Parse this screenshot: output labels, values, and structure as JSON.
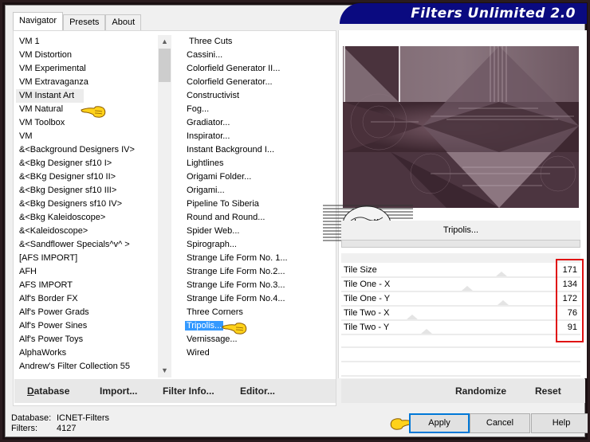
{
  "window": {
    "banner_title": "Filters Unlimited 2.0"
  },
  "tabs": [
    {
      "label": "Navigator",
      "active": true
    },
    {
      "label": "Presets",
      "active": false
    },
    {
      "label": "About",
      "active": false
    }
  ],
  "categories": {
    "selected": "VM Instant Art",
    "items": [
      "VM 1",
      "VM Distortion",
      "VM Experimental",
      "VM Extravaganza",
      "VM Instant Art",
      "VM Natural",
      "VM Toolbox",
      "VM",
      "&<Background Designers IV>",
      "&<Bkg Designer sf10 I>",
      "&<BKg Designer sf10 II>",
      "&<Bkg Designer sf10 III>",
      "&<Bkg Designers sf10 IV>",
      "&<Bkg Kaleidoscope>",
      "&<Kaleidoscope>",
      "&<Sandflower Specials^v^ >",
      "[AFS IMPORT]",
      "AFH",
      "AFS IMPORT",
      "Alf's Border FX",
      "Alf's Power Grads",
      "Alf's Power Sines",
      "Alf's Power Toys",
      "AlphaWorks",
      "Andrew's Filter Collection 55"
    ]
  },
  "filters": {
    "selected": "Tripolis...",
    "items": [
      "Three Cuts",
      "Cassini...",
      "Colorfield Generator II...",
      "Colorfield Generator...",
      "Constructivist",
      "Fog...",
      "Gradiator...",
      "Inspirator...",
      "Instant Background I...",
      "Lightlines",
      "Origami Folder...",
      "Origami...",
      "Pipeline To Siberia",
      "Round and Round...",
      "Spider Web...",
      "Spirograph...",
      "Strange Life Form No. 1...",
      "Strange Life Form No.2...",
      "Strange Life Form No.3...",
      "Strange Life Form No.4...",
      "Three Corners",
      "Tripolis...",
      "Vernissage...",
      "Wired"
    ]
  },
  "left_buttons": {
    "database": "Database",
    "import": "Import...",
    "filter_info": "Filter Info...",
    "editor": "Editor..."
  },
  "preview": {
    "filter_name": "Tripolis...",
    "watermark_text": "claudia"
  },
  "params": [
    {
      "label": "Tile Size",
      "value": "171",
      "fraction": 0.671
    },
    {
      "label": "Tile One - X",
      "value": "134",
      "fraction": 0.525
    },
    {
      "label": "Tile One - Y",
      "value": "172",
      "fraction": 0.675
    },
    {
      "label": "Tile Two - X",
      "value": "76",
      "fraction": 0.298
    },
    {
      "label": "Tile Two - Y",
      "value": "91",
      "fraction": 0.357
    }
  ],
  "right_buttons": {
    "randomize": "Randomize",
    "reset": "Reset"
  },
  "status": {
    "database_label": "Database:",
    "database_value": "ICNET-Filters",
    "filters_label": "Filters:",
    "filters_value": "4127"
  },
  "dialog_buttons": {
    "apply": "Apply",
    "cancel": "Cancel",
    "help": "Help"
  },
  "colors": {
    "banner": "#0a0a80",
    "selection": "#3399ff",
    "highlight_box": "#e01010",
    "default_button_border": "#0078d7"
  }
}
